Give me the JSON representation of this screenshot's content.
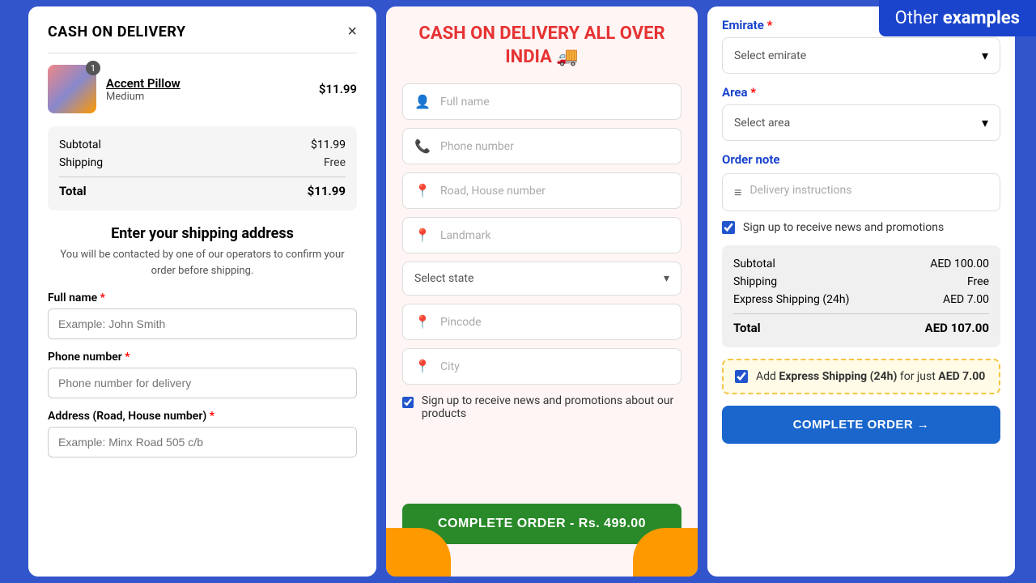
{
  "banner": {
    "text_static": "Other ",
    "text_bold": "examples"
  },
  "left_panel": {
    "title": "CASH ON DELIVERY",
    "close_button": "×",
    "product": {
      "name": "Accent Pillow",
      "variant": "Medium",
      "price": "$11.99",
      "badge": "1"
    },
    "summary": {
      "subtotal_label": "Subtotal",
      "subtotal_value": "$11.99",
      "shipping_label": "Shipping",
      "shipping_value": "Free",
      "total_label": "Total",
      "total_value": "$11.99"
    },
    "form": {
      "section_title": "Enter your shipping address",
      "section_subtitle": "You will be contacted by one of our operators to confirm your order before shipping.",
      "fields": [
        {
          "label": "Full name",
          "required": true,
          "placeholder": "Example: John Smith"
        },
        {
          "label": "Phone number",
          "required": true,
          "placeholder": "Phone number for delivery"
        },
        {
          "label": "Address (Road, House number)",
          "required": true,
          "placeholder": "Example: Minx Road 505 c/b"
        }
      ]
    }
  },
  "middle_panel": {
    "title": "CASH ON DELIVERY ALL OVER INDIA 🚚",
    "fields": [
      {
        "icon": "👤",
        "placeholder": "Full name"
      },
      {
        "icon": "📞",
        "placeholder": "Phone number"
      },
      {
        "icon": "📍",
        "placeholder": "Road, House number"
      },
      {
        "icon": "📍",
        "placeholder": "Landmark"
      }
    ],
    "state_select": {
      "label": "Select state",
      "has_chevron": true
    },
    "fields2": [
      {
        "icon": "📍",
        "placeholder": "Pincode"
      },
      {
        "icon": "📍",
        "placeholder": "City"
      }
    ],
    "checkbox": {
      "checked": true,
      "label": "Sign up to receive news and promotions about our products"
    },
    "complete_button": "COMPLETE ORDER - Rs. 499.00"
  },
  "right_panel": {
    "emirate_label": "Emirate",
    "emirate_required": true,
    "emirate_placeholder": "Select emirate",
    "area_label": "Area",
    "area_required": true,
    "area_placeholder": "Select area",
    "order_note_label": "Order note",
    "delivery_instructions_placeholder": "Delivery instructions",
    "signup_checkbox": {
      "checked": true,
      "label": "Sign up to receive news and promotions"
    },
    "summary": {
      "subtotal_label": "Subtotal",
      "subtotal_value": "AED 100.00",
      "shipping_label": "Shipping",
      "shipping_value": "Free",
      "express_label": "Express Shipping (24h)",
      "express_value": "AED 7.00",
      "total_label": "Total",
      "total_value": "AED 107.00"
    },
    "express_banner": {
      "checked": true,
      "text": "Add ",
      "bold_text": "Express Shipping (24h)",
      "text2": " for just ",
      "price": "AED 7.00"
    },
    "complete_button": "COMPLETE ORDER →"
  }
}
